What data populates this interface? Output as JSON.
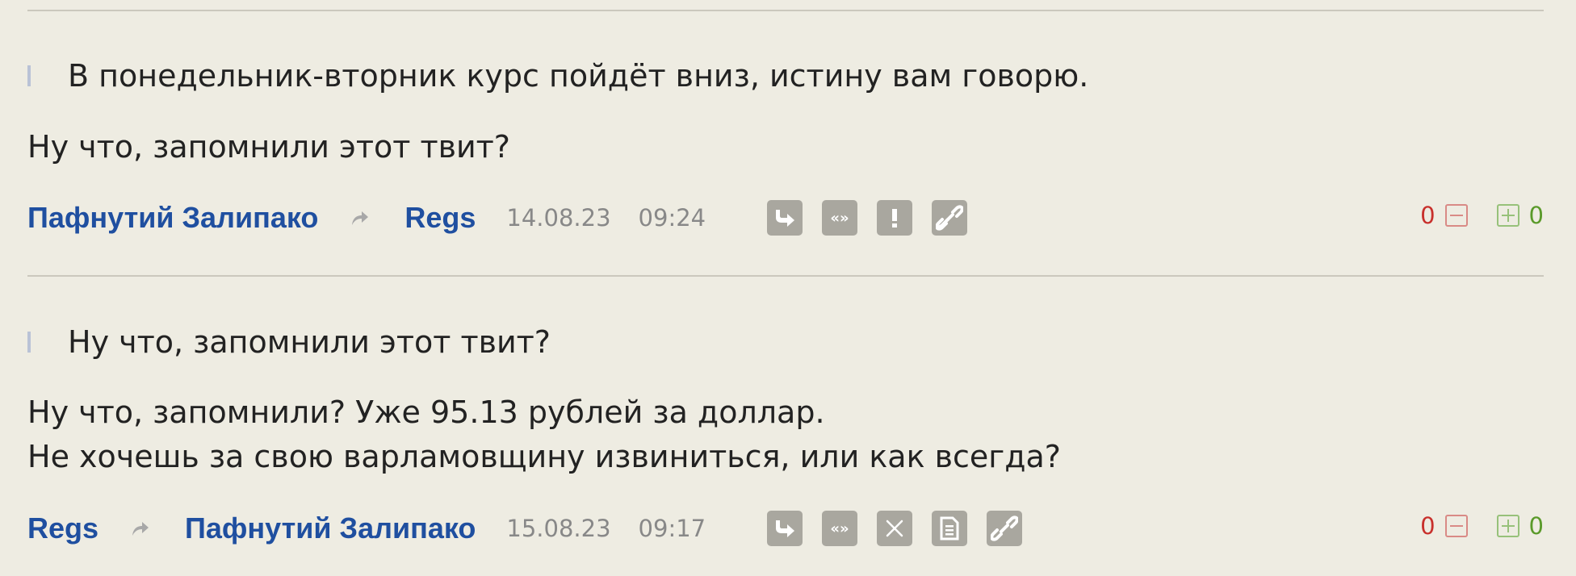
{
  "colors": {
    "background": "#eeece2",
    "author_link": "#1f4fa0",
    "negative": "#c8302c",
    "positive": "#5a9a2a",
    "action_button": "#a9a79f"
  },
  "comments": [
    {
      "quote": "В понедельник-вторник курс пойдёт вниз, истину вам говорю.",
      "body_lines": [
        "Ну что, запомнили этот твит?"
      ],
      "author": "Пафнутий Залипако",
      "reply_to": "Regs",
      "date": "14.08.23",
      "time": "09:24",
      "actions": [
        "reply-icon",
        "quote-icon",
        "report-icon",
        "link-icon"
      ],
      "votes": {
        "minus": "0",
        "plus": "0"
      }
    },
    {
      "quote": "Ну что, запомнили этот твит?",
      "body_lines": [
        "Ну что, запомнили? Уже 95.13 рублей за доллар.",
        "Не хочешь за свою варламовщину извиниться, или как всегда?"
      ],
      "author": "Regs",
      "reply_to": "Пафнутий Залипако",
      "date": "15.08.23",
      "time": "09:17",
      "actions": [
        "reply-icon",
        "quote-icon",
        "close-icon",
        "document-icon",
        "link-icon"
      ],
      "votes": {
        "minus": "0",
        "plus": "0"
      }
    }
  ]
}
